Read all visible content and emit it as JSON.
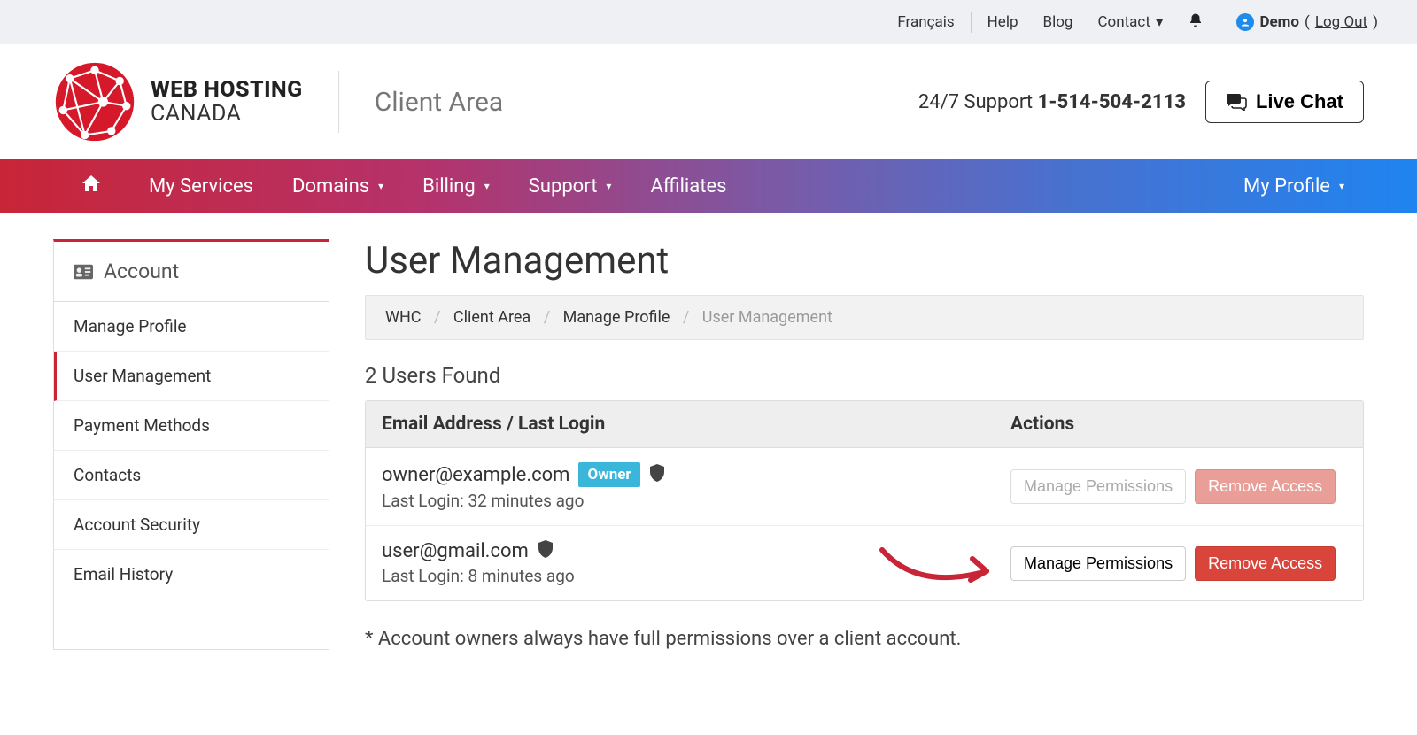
{
  "topbar": {
    "lang": "Français",
    "help": "Help",
    "blog": "Blog",
    "contact": "Contact",
    "demo_label": "Demo",
    "logout": "Log Out"
  },
  "header": {
    "brand_line1": "WEB HOSTING",
    "brand_line2": "CANADA",
    "client_area": "Client Area",
    "support_prefix": "24/7 Support ",
    "support_phone": "1-514-504-2113",
    "live_chat": "Live Chat"
  },
  "nav": {
    "my_services": "My Services",
    "domains": "Domains",
    "billing": "Billing",
    "support": "Support",
    "affiliates": "Affiliates",
    "my_profile": "My Profile"
  },
  "sidebar": {
    "header": "Account",
    "items": [
      {
        "label": "Manage Profile"
      },
      {
        "label": "User Management"
      },
      {
        "label": "Payment Methods"
      },
      {
        "label": "Contacts"
      },
      {
        "label": "Account Security"
      },
      {
        "label": "Email History"
      }
    ]
  },
  "page": {
    "title": "User Management",
    "breadcrumb": {
      "root": "WHC",
      "area": "Client Area",
      "profile": "Manage Profile",
      "current": "User Management"
    },
    "users_found": "2 Users Found",
    "table": {
      "col_email": "Email Address / Last Login",
      "col_actions": "Actions"
    },
    "rows": [
      {
        "email": "owner@example.com",
        "badge": "Owner",
        "last_login": "Last Login: 32 minutes ago",
        "manage": "Manage Permissions",
        "remove": "Remove Access"
      },
      {
        "email": "user@gmail.com",
        "last_login": "Last Login: 8 minutes ago",
        "manage": "Manage Permissions",
        "remove": "Remove Access"
      }
    ],
    "footnote": "* Account owners always have full permissions over a client account."
  }
}
